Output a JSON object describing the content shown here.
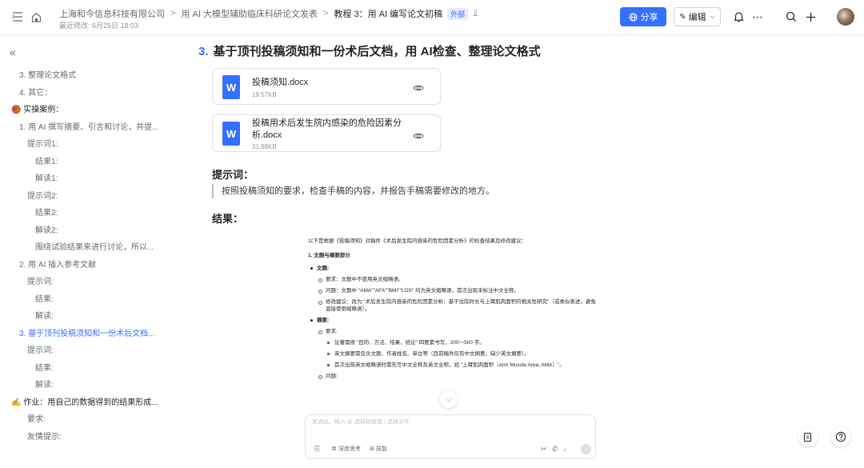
{
  "header": {
    "breadcrumbs": [
      "上海和今信息科技有限公司",
      "用 AI 大模型辅助临床科研论文发表",
      "教程 3：用 AI 编写论文初稿"
    ],
    "external_badge": "外部",
    "last_modified": "最近修改: 6月25日 18:03",
    "share_label": "分享",
    "edit_label": "编辑"
  },
  "toc": {
    "items": [
      {
        "label": "3. 整理论文格式",
        "level": 1
      },
      {
        "label": "4. 其它：",
        "level": 1
      },
      {
        "label": "🏀 实操案例：",
        "level": 0
      },
      {
        "label": "1. 用 AI 撰写摘要、引言和讨论，并提...",
        "level": 1
      },
      {
        "label": "提示词1:",
        "level": 2
      },
      {
        "label": "结果1:",
        "level": 3
      },
      {
        "label": "解读1:",
        "level": 3
      },
      {
        "label": "提示词2:",
        "level": 2
      },
      {
        "label": "结果2:",
        "level": 3
      },
      {
        "label": "解读2:",
        "level": 3
      },
      {
        "label": "围绕试验结果来进行讨论，所以...",
        "level": 3
      },
      {
        "label": "2. 用 AI 插入参考文献",
        "level": 1
      },
      {
        "label": "提示词:",
        "level": 2
      },
      {
        "label": "结果:",
        "level": 3
      },
      {
        "label": "解读:",
        "level": 3
      },
      {
        "label": "3. 基于顶刊投稿须知和一份术后文档...",
        "level": 1,
        "active": true
      },
      {
        "label": "提示词:",
        "level": 2
      },
      {
        "label": "结果:",
        "level": 3
      },
      {
        "label": "解读:",
        "level": 3
      },
      {
        "label": "✍️ 作业：用自己的数据得到的结果形成...",
        "level": 0
      },
      {
        "label": "要求:",
        "level": 2
      },
      {
        "label": "友情提示:",
        "level": 2
      }
    ]
  },
  "main": {
    "heading_num": "3.",
    "heading_text": "基于顶刊投稿须知和一份术后文档，用 AI检查、整理论文格式",
    "files": [
      {
        "icon": "W",
        "name": "投稿须知.docx",
        "size": "19.57KB"
      },
      {
        "icon": "W",
        "name": "投稿用术后发生院内感染的危险因素分析.docx",
        "size": "31.98KB"
      }
    ],
    "prompt_heading": "提示词：",
    "prompt_text": "按照投稿须知的要求，检查手稿的内容，并报告手稿需要修改的地方。",
    "result_heading": "结果：",
    "result": {
      "intro": "以下是根据《投稿须知》对稿件《术后发生院内感染的危险因素分析》的检查结果及修改建议：",
      "section1": "1. 文题与摘要部分",
      "b1": "文题:",
      "b1_items": [
        "要求：文题中不使用英文缩略语。",
        "问题：文题中 \"AMA\"\"AFA\"\"BMI\"\"LOS\" 均为英文缩略语，首次出现未标注中文全称。",
        "修改建议：改为 \"术后发生院内感染的危险因素分析：基于住院时长与上臂肌肉面积的相关性研究\"（或类似表述，避免直接使用缩略语）。"
      ],
      "b2": "摘要:",
      "b2_sub": "要求:",
      "b2_items": [
        "论著需按 \"目的、方法、结果、结论\" 四要素书写，200～500 字。",
        "英文摘要需包含文题、作者姓名、单位等（目前稿件仅有中文摘要，缺少英文摘要）。",
        "首次出现英文缩略语时需先写中文全称及英文全称，如 \"上臂肌肉面积（Arm Muscle Area, AMA）\"。"
      ],
      "b2_problem": "问题:"
    },
    "chat": {
      "placeholder": "发消息、输入 @ 选择技能或 / 选择文件",
      "deep_think": "深度思考",
      "skills": "技能"
    }
  }
}
